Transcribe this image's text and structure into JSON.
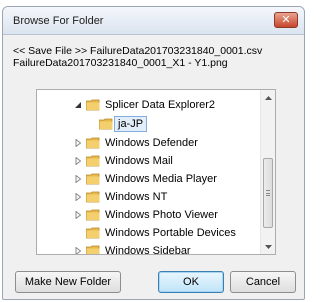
{
  "window": {
    "title": "Browse For Folder",
    "close_symbol": "✕"
  },
  "description": {
    "line1": "<< Save File >> FailureData201703231840_0001.csv",
    "line2": "FailureData201703231840_0001_X1 - Y1.png"
  },
  "tree": {
    "items": [
      {
        "label": "Splicer Data Explorer2",
        "level": 0,
        "arrow": "expanded",
        "selected": false
      },
      {
        "label": "ja-JP",
        "level": 1,
        "arrow": "none",
        "selected": true
      },
      {
        "label": "Windows Defender",
        "level": 0,
        "arrow": "collapsed",
        "selected": false
      },
      {
        "label": "Windows Mail",
        "level": 0,
        "arrow": "collapsed",
        "selected": false
      },
      {
        "label": "Windows Media Player",
        "level": 0,
        "arrow": "collapsed",
        "selected": false
      },
      {
        "label": "Windows NT",
        "level": 0,
        "arrow": "collapsed",
        "selected": false
      },
      {
        "label": "Windows Photo Viewer",
        "level": 0,
        "arrow": "collapsed",
        "selected": false
      },
      {
        "label": "Windows Portable Devices",
        "level": 0,
        "arrow": "none",
        "selected": false
      },
      {
        "label": "Windows Sidebar",
        "level": 0,
        "arrow": "collapsed",
        "selected": false
      }
    ]
  },
  "buttons": {
    "make_new_folder": "Make New Folder",
    "ok": "OK",
    "cancel": "Cancel"
  },
  "colors": {
    "folder": "#e8b84a",
    "selection": "#e3eefb"
  }
}
